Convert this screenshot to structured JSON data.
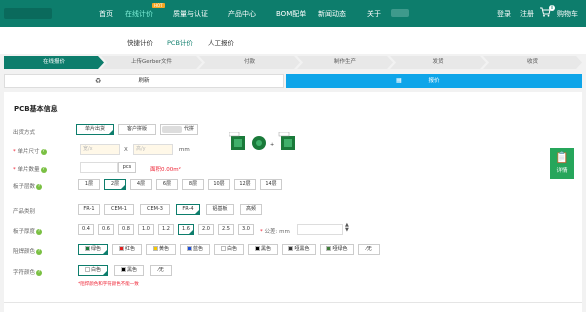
{
  "nav": {
    "items": [
      "首页",
      "在线计价",
      "质量与认证",
      "产品中心",
      "BOM配单",
      "新闻动态",
      "关于"
    ],
    "hot_badge": "HOT",
    "login": "登录",
    "register": "注册",
    "cart": "购物车",
    "cart_count": "0",
    "colors": {
      "bar": "#0d7d6c",
      "active_text": "#7ff0d9"
    }
  },
  "subnav": {
    "tabs": [
      "快捷计价",
      "PCB计价",
      "人工报价"
    ],
    "active": "PCB计价"
  },
  "steps": [
    "在线报价",
    "上传Gerber文件",
    "付款",
    "制作生产",
    "发货",
    "收货"
  ],
  "actions": {
    "refresh": "刷新",
    "quote": "报价"
  },
  "form": {
    "section_title": "PCB基本信息",
    "outgoing": {
      "label": "出货方式",
      "options": [
        "单片出货",
        "客户拼版",
        "代拼"
      ]
    },
    "size": {
      "label": "单片尺寸",
      "length_placeholder": "宽/x",
      "sep": "X",
      "width_placeholder": "高/y",
      "unit": "mm"
    },
    "qty": {
      "label": "单片数量",
      "unit": "pcs",
      "area_label": "面积",
      "area_value": "0.00m²"
    },
    "layers": {
      "label": "板子层数",
      "options": [
        "1层",
        "2层",
        "4层",
        "6层",
        "8层",
        "10层",
        "12层",
        "14层"
      ],
      "selected": "2层"
    },
    "material": {
      "label": "产品类别",
      "options": [
        "FR-1",
        "CEM-1",
        "CEM-3",
        "FR-4",
        "铝基板",
        "高频"
      ],
      "selected": "FR-4"
    },
    "thickness": {
      "label": "板子厚度",
      "options": [
        "0.4",
        "0.6",
        "0.8",
        "1.0",
        "1.2",
        "1.6",
        "2.0",
        "2.5",
        "3.0"
      ],
      "selected": "1.6",
      "tolerance_label": "公差: mm"
    },
    "mask_color": {
      "label": "阻焊颜色",
      "options": [
        "绿色",
        "红色",
        "黄色",
        "蓝色",
        "白色",
        "黑色",
        "哑黑色",
        "哑绿色",
        "无"
      ],
      "selected": "绿色"
    },
    "silk_color": {
      "label": "字符颜色",
      "options": [
        "白色",
        "黑色",
        "无"
      ],
      "selected": "白色"
    },
    "note": "*阻焊颜色和字符颜色不能一致"
  },
  "detail_button": "详情"
}
